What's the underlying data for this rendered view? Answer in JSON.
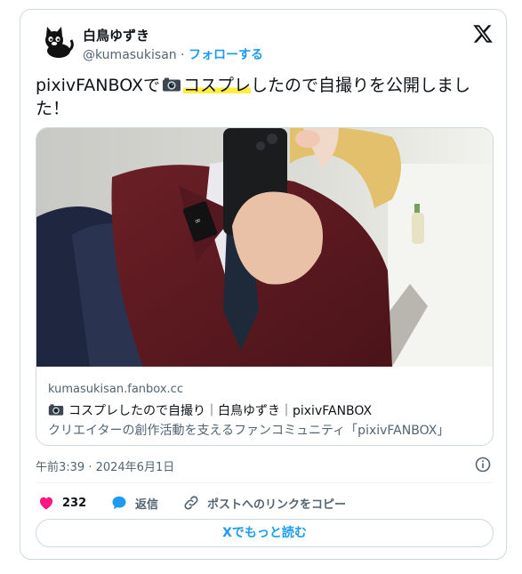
{
  "author": {
    "display_name": "白鳥ゆずき",
    "handle": "@kumasukisan",
    "separator": "·",
    "follow_label": "フォローする",
    "avatar_icon": "black-cat-icon"
  },
  "tweet": {
    "text_before": "pixivFANBOXで",
    "emoji": "camera-icon",
    "highlight": "コスプレ",
    "text_after": "したので自撮りを公開しました！"
  },
  "link_card": {
    "domain": "kumasukisan.fanbox.cc",
    "title": "コスプレしたので自撮り｜白鳥ゆずき｜pixivFANBOX",
    "description": "クリエイターの創作活動を支えるファンコミュニティ「pixivFANBOX」"
  },
  "timestamp": "午前3:39 · 2024年6月1日",
  "actions": {
    "like_count": "232",
    "reply_label": "返信",
    "copy_link_label": "ポストへのリンクをコピー"
  },
  "read_more_label": "Xでもっと読む",
  "colors": {
    "accent": "#1d9bf0",
    "like": "#f91880",
    "highlight": "#ffef3a",
    "muted_text": "#536471"
  }
}
